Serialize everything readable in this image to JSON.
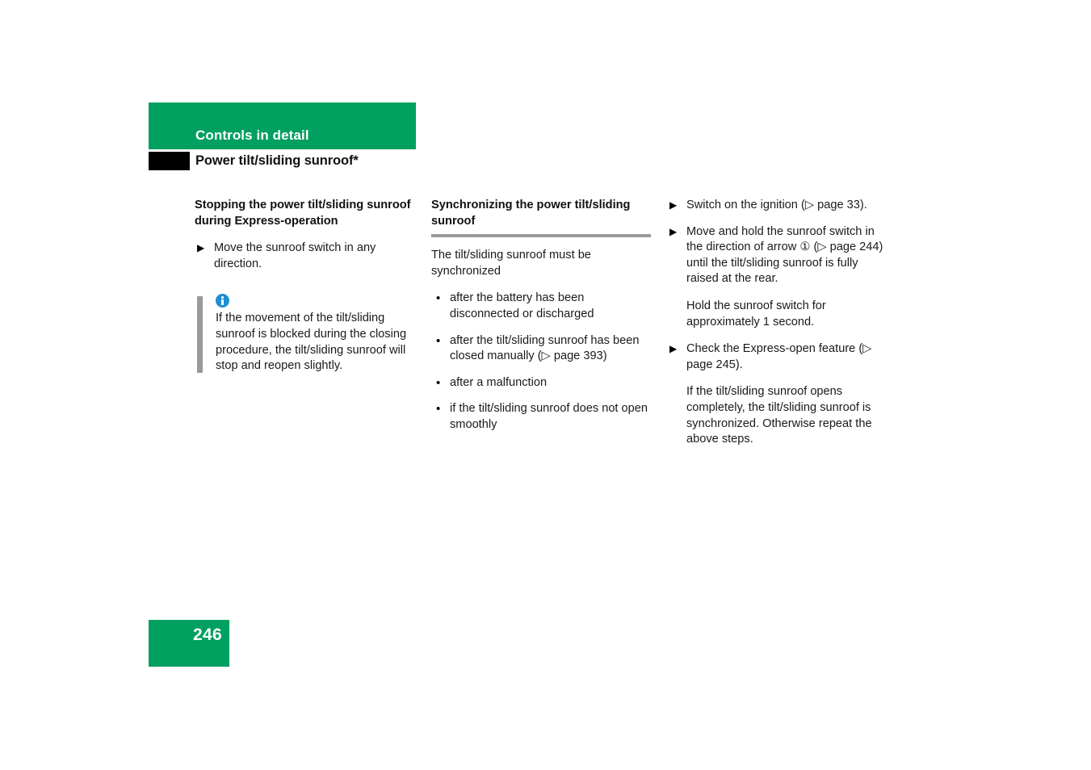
{
  "header": {
    "chapter_title": "Controls in detail",
    "section_title": "Power tilt/sliding sunroof*",
    "green_color": "#00a060",
    "tab_color": "#000000"
  },
  "columns": [
    {
      "id": "column-1",
      "heading": "Stopping the power tilt/sliding sunroof during Express-operation",
      "has_rule": false,
      "steps": [
        {
          "marker": "▶",
          "text": "Move the sunroof switch in any direction."
        }
      ],
      "note": {
        "icon": "info-icon",
        "icon_color": "#1d8fd1",
        "bar_color": "#9a9a9a",
        "text": "If the movement of the tilt/sliding sunroof is blocked during the closing procedure, the tilt/sliding sunroof will stop and reopen slightly."
      }
    },
    {
      "id": "column-2",
      "heading": "Synchronizing the power tilt/sliding sunroof",
      "has_rule": true,
      "rule_color": "#9a9a9a",
      "intro": "The tilt/sliding sunroof must be synchronized",
      "bullets": [
        {
          "marker": "•",
          "text": "after the battery has been disconnected or discharged"
        },
        {
          "marker": "•",
          "text": "after the tilt/sliding sunroof has been closed manually (▷ page 393)"
        },
        {
          "marker": "•",
          "text": "after a malfunction"
        },
        {
          "marker": "•",
          "text": "if the tilt/sliding sunroof does not open smoothly"
        }
      ]
    },
    {
      "id": "column-3",
      "steps": [
        {
          "marker": "▶",
          "text": "Switch on the ignition (▷ page 33)."
        },
        {
          "marker": "▶",
          "text": "Move and hold the sunroof switch in the direction of arrow ① (▷ page 244) until the tilt/sliding sunroof is fully raised at the rear."
        }
      ],
      "step2_note": "Hold the sunroof switch for approximately 1 second.",
      "step3": {
        "marker": "▶",
        "text": "Check the Express-open feature (▷ page 245)."
      },
      "step3_note": "If the tilt/sliding sunroof opens completely, the tilt/sliding sunroof is synchronized. Otherwise repeat the above steps."
    }
  ],
  "footer": {
    "page_number": "246",
    "box_color": "#00a060"
  }
}
